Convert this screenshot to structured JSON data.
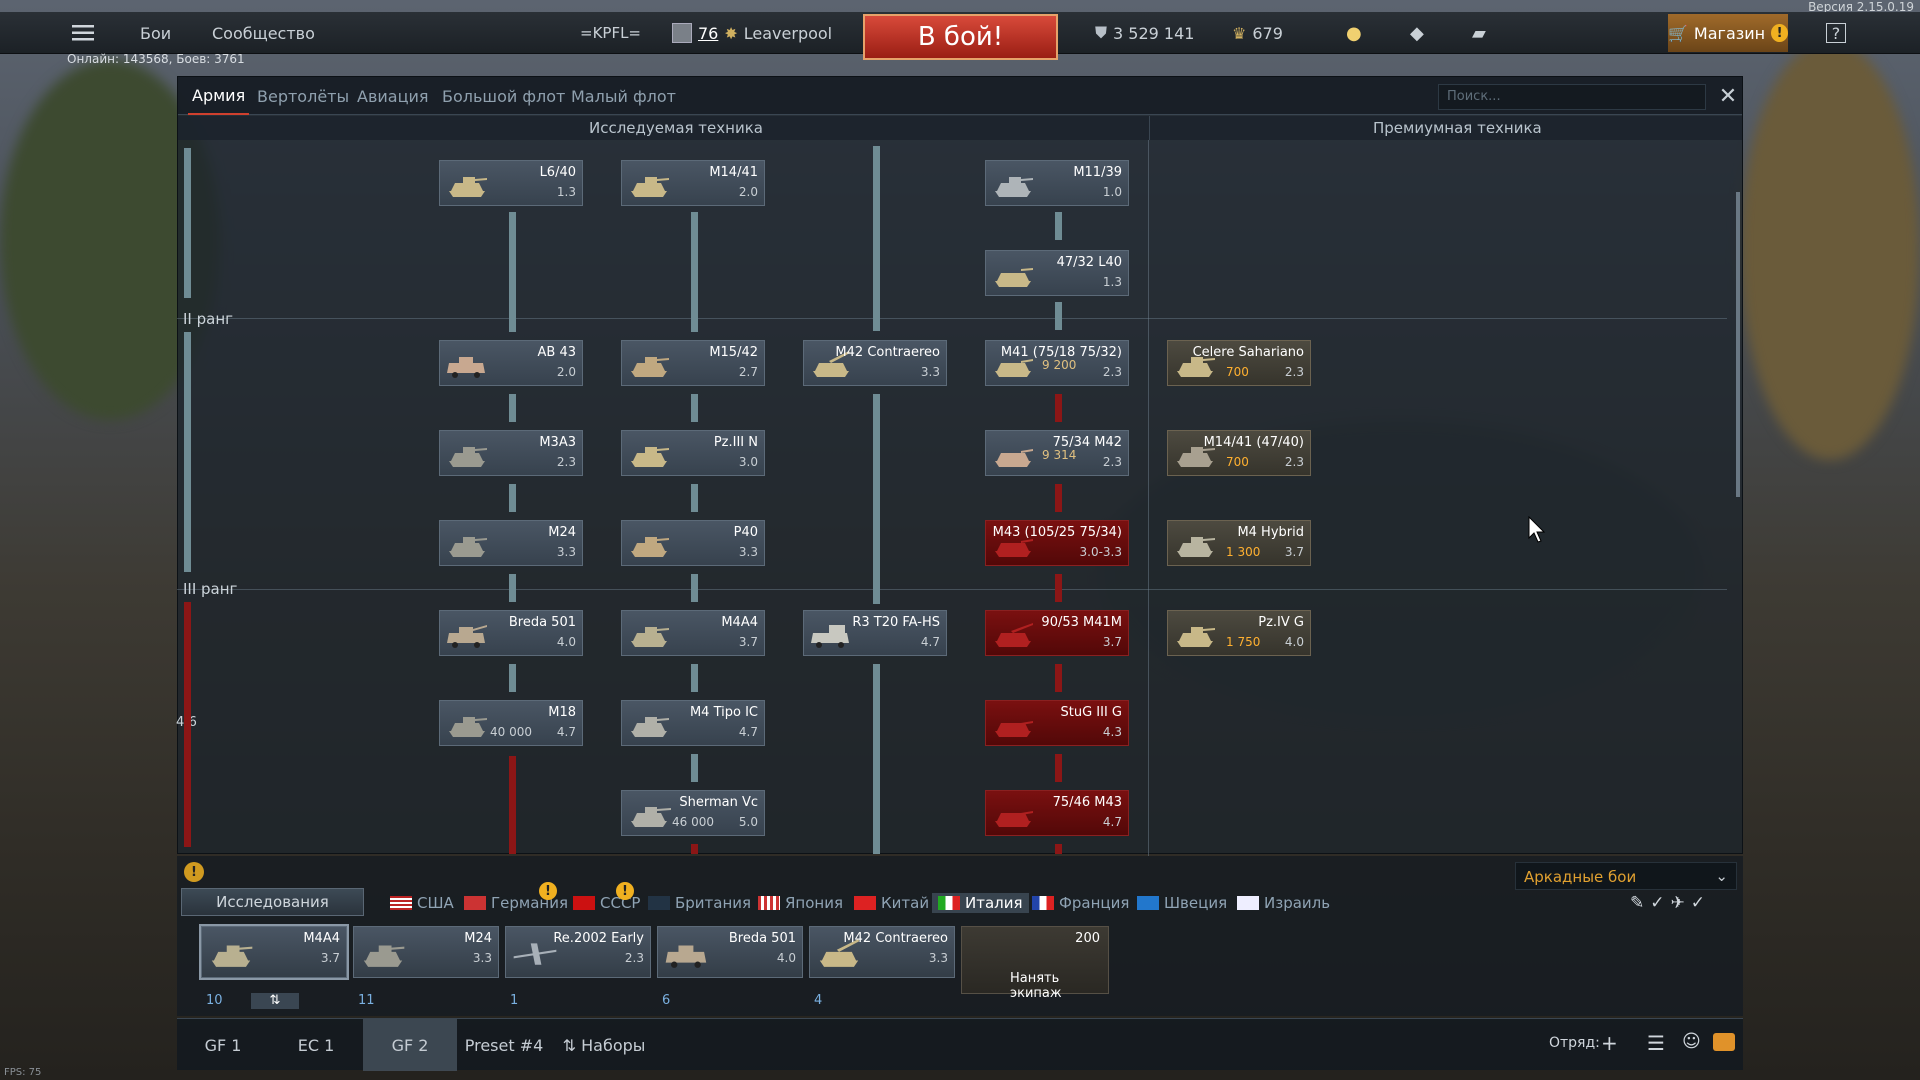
{
  "version": "Версия 2.15.0.19",
  "online": "Онлайн: 143568, Боев: 3761",
  "fps": "FPS: 75",
  "topbar": {
    "battles": "Бои",
    "community": "Сообщество",
    "squadron": "=KPFL=",
    "level": "76",
    "nickname": "Leaverpool",
    "battle_button": "В бой!",
    "silver": "3 529 141",
    "gold": "679",
    "shop": "Магазин"
  },
  "tabs": [
    "Армия",
    "Вертолёты",
    "Авиация",
    "Большой флот",
    "Малый флот"
  ],
  "search_placeholder": "Поиск...",
  "sections": {
    "researched": "Исследуемая техника",
    "premium": "Премиумная техника"
  },
  "ranks": {
    "r2": "II ранг",
    "r3": "III ранг",
    "progress": "4/6"
  },
  "cards": [
    {
      "name": "L6/40",
      "br": "1.3"
    },
    {
      "name": "M14/41",
      "br": "2.0"
    },
    {
      "name": "M11/39",
      "br": "1.0"
    },
    {
      "name": "47/32 L40",
      "br": "1.3"
    },
    {
      "name": "AB 43",
      "br": "2.0"
    },
    {
      "name": "M15/42",
      "br": "2.7"
    },
    {
      "name": "M42 Contraereo",
      "br": "3.3"
    },
    {
      "name": "M41 (75/18 75/32)",
      "br": "2.3",
      "rp": "9 200"
    },
    {
      "name": "M3A3",
      "br": "2.3"
    },
    {
      "name": "Pz.III N",
      "br": "3.0"
    },
    {
      "name": "75/34 M42",
      "br": "2.3",
      "rp": "9 314"
    },
    {
      "name": "M24",
      "br": "3.3"
    },
    {
      "name": "P40",
      "br": "3.3"
    },
    {
      "name": "M43 (105/25 75/34)",
      "br": "3.0-3.3"
    },
    {
      "name": "Breda 501",
      "br": "4.0"
    },
    {
      "name": "M4A4",
      "br": "3.7"
    },
    {
      "name": "R3 T20 FA-HS",
      "br": "4.7"
    },
    {
      "name": "90/53 M41M",
      "br": "3.7"
    },
    {
      "name": "M18",
      "br": "4.7",
      "rp": "40 000"
    },
    {
      "name": "M4 Tipo IC",
      "br": "4.7"
    },
    {
      "name": "StuG III G",
      "br": "4.3"
    },
    {
      "name": "Sherman Vc",
      "br": "5.0",
      "rp": "46 000"
    },
    {
      "name": "75/46 M43",
      "br": "4.7"
    }
  ],
  "premium": [
    {
      "name": "Celere Sahariano",
      "cost": "700",
      "br": "2.3"
    },
    {
      "name": "M14/41 (47/40)",
      "cost": "700",
      "br": "2.3"
    },
    {
      "name": "M4 Hybrid",
      "cost": "1 300",
      "br": "3.7"
    },
    {
      "name": "Pz.IV G",
      "cost": "1 750",
      "br": "4.0"
    }
  ],
  "gamemode": "Аркадные бои",
  "research_button": "Исследования",
  "nations": [
    "США",
    "Германия",
    "СССР",
    "Британия",
    "Япония",
    "Китай",
    "Италия",
    "Франция",
    "Швеция",
    "Израиль"
  ],
  "slots": [
    {
      "name": "M4A4",
      "br": "3.7",
      "num": "10"
    },
    {
      "name": "M24",
      "br": "3.3",
      "num": "11"
    },
    {
      "name": "Re.2002 Early",
      "br": "2.3",
      "num": "1"
    },
    {
      "name": "Breda 501",
      "br": "4.0",
      "num": "6"
    },
    {
      "name": "M42 Contraereo",
      "br": "3.3",
      "num": "4"
    }
  ],
  "crew": {
    "cost": "200",
    "label": "Нанять экипаж"
  },
  "presets": [
    "GF 1",
    "EC 1",
    "GF 2",
    "Preset #4",
    "Наборы"
  ],
  "squad": "Отряд:"
}
